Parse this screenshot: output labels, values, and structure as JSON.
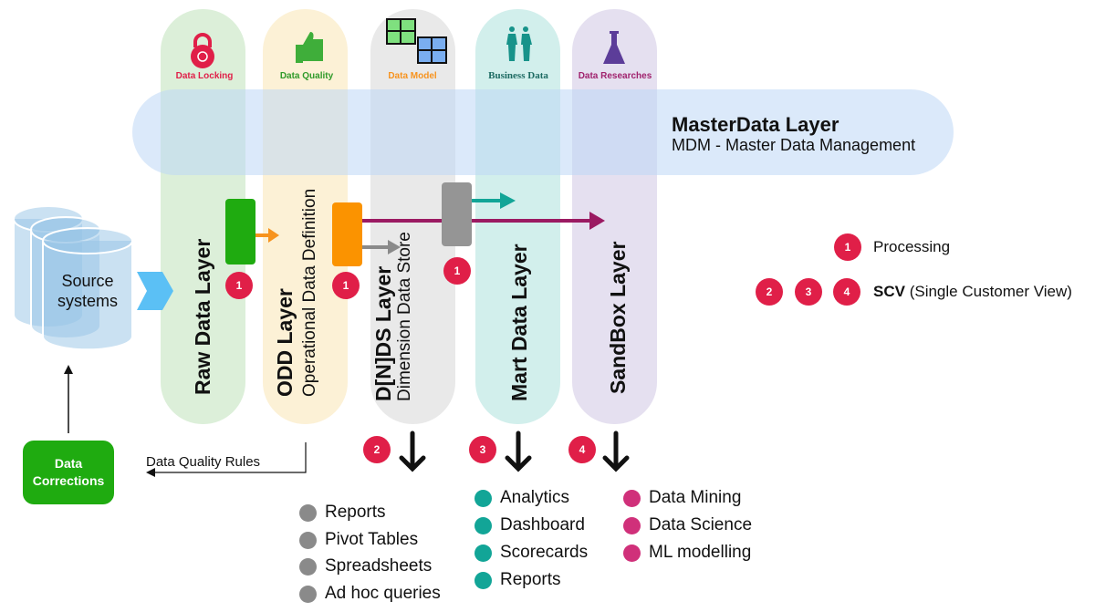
{
  "columns": [
    {
      "icon_label": "Data Locking",
      "title": "Raw Data Layer",
      "subtitle": "",
      "color": "#dcefd9",
      "label_color": "#e01f48"
    },
    {
      "icon_label": "Data Quality",
      "title": "ODD Layer",
      "subtitle": "Operational Data Definition",
      "color": "#fcf1d6",
      "label_color": "#2f9a2a"
    },
    {
      "icon_label": "Data Model",
      "title": "D[N]DS Layer",
      "subtitle": "Dimension Data Store",
      "color": "#e9e9e9",
      "label_color": "#f7931e"
    },
    {
      "icon_label": "Business Data",
      "title": "Mart Data Layer",
      "subtitle": "",
      "color": "#d2efec",
      "label_color": "#1e6b63"
    },
    {
      "icon_label": "Data Researches",
      "title": "SandBox Layer",
      "subtitle": "",
      "color": "#e5e0f0",
      "label_color": "#a0226d"
    }
  ],
  "master": {
    "title": "MasterData Layer",
    "subtitle": "MDM - Master Data Management"
  },
  "source": "Source systems",
  "corrections": "Data Corrections",
  "rules": "Data Quality Rules",
  "legend": {
    "processing_badge": "1",
    "processing": "Processing",
    "scv_badges": [
      "2",
      "3",
      "4"
    ],
    "scv_bold": "SCV",
    "scv_rest": " (Single Customer View)"
  },
  "process_badges": [
    "1",
    "1",
    "1"
  ],
  "outputs": [
    {
      "badge": "2",
      "color": "#8a8a8a",
      "items": [
        "Reports",
        "Pivot Tables",
        "Spreadsheets",
        "Ad hoc queries"
      ]
    },
    {
      "badge": "3",
      "color": "#12a597",
      "items": [
        "Analytics",
        "Dashboard",
        "Scorecards",
        "Reports"
      ]
    },
    {
      "badge": "4",
      "color": "#d0307a",
      "items": [
        "Data Mining",
        "Data Science",
        "ML modelling"
      ]
    }
  ]
}
